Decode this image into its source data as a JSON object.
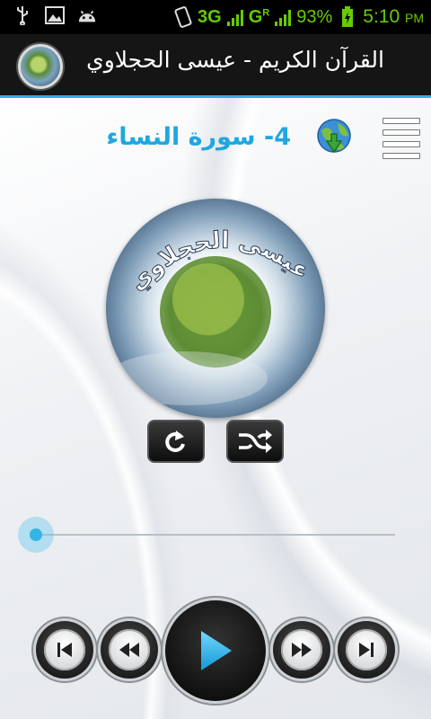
{
  "status_bar": {
    "network": "3G",
    "network2": "G",
    "network2_sup": "R",
    "battery": "93%",
    "time": "5:10",
    "ampm": "PM",
    "accent": "#66cc00"
  },
  "action_bar": {
    "title": "القرآن الكريم - عيسى الحجلاوي",
    "accent": "#2ab0e6"
  },
  "player": {
    "surah_title": "4- سورة النساء",
    "reciter_art_text": "عيسى الحجلاوي",
    "progress": 0.0,
    "controls": [
      "repeat",
      "shuffle"
    ],
    "transport": [
      "skip-previous",
      "rewind",
      "play",
      "fast-forward",
      "skip-next"
    ],
    "accent": "#1fa7e0"
  }
}
